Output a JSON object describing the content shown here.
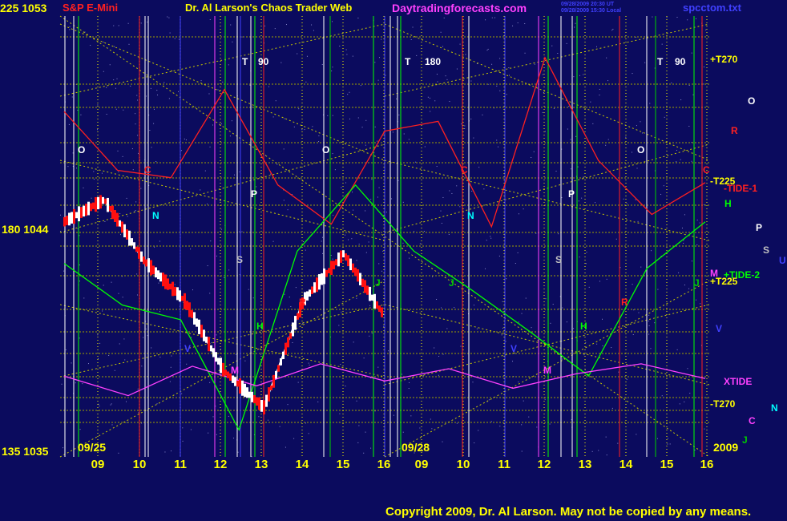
{
  "header": {
    "symbol_info": "S&P E-Mini",
    "title": "Dr. Al Larson's Chaos Trader Web",
    "website": "Daytradingforecasts.com",
    "timestamp_1": "09/28/2009 20:30 UT",
    "timestamp_2": "09/28/2009 15:30 Local",
    "filename": "spcctom.txt"
  },
  "left_axis": {
    "top": "225 1053",
    "mid": "180 1044",
    "bottom": "135 1035"
  },
  "date_labels": [
    "09/25",
    "09/28"
  ],
  "year_label": "2009",
  "x_ticks": [
    "09",
    "10",
    "11",
    "12",
    "13",
    "14",
    "15",
    "16",
    "09",
    "10",
    "11",
    "12",
    "13",
    "14",
    "15",
    "16"
  ],
  "copyright": "Copyright 2009, Dr. Al Larson. May not be copied by any means.",
  "planet_markers": [
    {
      "text": "O",
      "color": "#ffffff"
    },
    {
      "text": "O",
      "color": "#ffffff"
    },
    {
      "text": "O",
      "color": "#ffffff"
    },
    {
      "text": "T",
      "color": "#ffffff"
    },
    {
      "text": "90",
      "color": "#ffffff"
    },
    {
      "text": "T",
      "color": "#ffffff"
    },
    {
      "text": "180",
      "color": "#ffffff"
    },
    {
      "text": "T",
      "color": "#ffffff"
    },
    {
      "text": "90",
      "color": "#ffffff"
    },
    {
      "text": "P",
      "color": "#ffffff"
    },
    {
      "text": "P",
      "color": "#ffffff"
    },
    {
      "text": "S",
      "color": "#c0c0c0"
    },
    {
      "text": "S",
      "color": "#c0c0c0"
    },
    {
      "text": "N",
      "color": "#00ffff"
    },
    {
      "text": "N",
      "color": "#00ffff"
    },
    {
      "text": "V",
      "color": "#4040ff"
    },
    {
      "text": "V",
      "color": "#4040ff"
    },
    {
      "text": "H",
      "color": "#00ff00"
    },
    {
      "text": "H",
      "color": "#00ff00"
    },
    {
      "text": "J",
      "color": "#00cc00"
    },
    {
      "text": "J",
      "color": "#00cc00"
    },
    {
      "text": "J",
      "color": "#00cc00"
    },
    {
      "text": "C",
      "color": "#ff2020"
    },
    {
      "text": "C",
      "color": "#ff2020"
    },
    {
      "text": "C",
      "color": "#ff2020"
    },
    {
      "text": "R",
      "color": "#ff2020"
    },
    {
      "text": "R",
      "color": "#ff2020"
    },
    {
      "text": "M",
      "color": "#ff40ff"
    },
    {
      "text": "M",
      "color": "#ff40ff"
    }
  ],
  "right_legend": [
    {
      "text": "+T270",
      "color": "#ffff00"
    },
    {
      "text": "O",
      "color": "#ffffff"
    },
    {
      "text": "R",
      "color": "#ff2020"
    },
    {
      "text": "-T225",
      "color": "#ffff00"
    },
    {
      "text": "-TIDE-1",
      "color": "#ff2020"
    },
    {
      "text": "H",
      "color": "#00ff00"
    },
    {
      "text": "P",
      "color": "#ffffff"
    },
    {
      "text": "S",
      "color": "#c0c0c0"
    },
    {
      "text": "U",
      "color": "#4040ff"
    },
    {
      "text": "M",
      "color": "#ff40ff"
    },
    {
      "text": "+TIDE-2",
      "color": "#00ff00"
    },
    {
      "text": "+T225",
      "color": "#ffff00"
    },
    {
      "text": "V",
      "color": "#4040ff"
    },
    {
      "text": "XTIDE",
      "color": "#ff40ff"
    },
    {
      "text": "-T270",
      "color": "#ffff00"
    },
    {
      "text": "N",
      "color": "#00ffff"
    },
    {
      "text": "C",
      "color": "#ff40ff"
    },
    {
      "text": "J",
      "color": "#00cc00"
    }
  ],
  "chart_data": {
    "type": "line",
    "title": "S&P E-Mini",
    "ylim": [
      1035,
      1053
    ],
    "yticks": [
      1035,
      1044,
      1053
    ],
    "x": [
      "09",
      "10",
      "11",
      "12",
      "13",
      "14",
      "15",
      "16",
      "09",
      "10",
      "11",
      "12",
      "13",
      "14",
      "15",
      "16"
    ],
    "series": [
      {
        "name": "S&P E-Mini",
        "color": "#ffffff",
        "values": [
          1044.6,
          1045.5,
          1043.0,
          1041.4,
          1038.5,
          1037.0,
          1041.4,
          1043.3,
          1040.8
        ]
      },
      {
        "name": "TIDE-1",
        "color": "#ff2020",
        "values": [
          1049.1,
          1046.7,
          1046.4,
          1050.0,
          1046.1,
          1044.5,
          1048.3,
          1048.7,
          1044.4,
          1051.3,
          1047.1,
          1044.9,
          1046.2
        ]
      },
      {
        "name": "TIDE-2",
        "color": "#00ff00",
        "values": [
          1042.9,
          1041.2,
          1040.6,
          1036.1,
          1043.4,
          1046.1,
          1043.4,
          1041.8,
          1040.1,
          1038.3,
          1042.7,
          1044.6
        ]
      },
      {
        "name": "XTIDE",
        "color": "#ff40ff",
        "values": [
          1038.3,
          1037.5,
          1038.7,
          1037.9,
          1038.8,
          1038.1,
          1038.6,
          1037.8,
          1038.4,
          1038.8,
          1038.2
        ]
      }
    ],
    "grid": true
  }
}
